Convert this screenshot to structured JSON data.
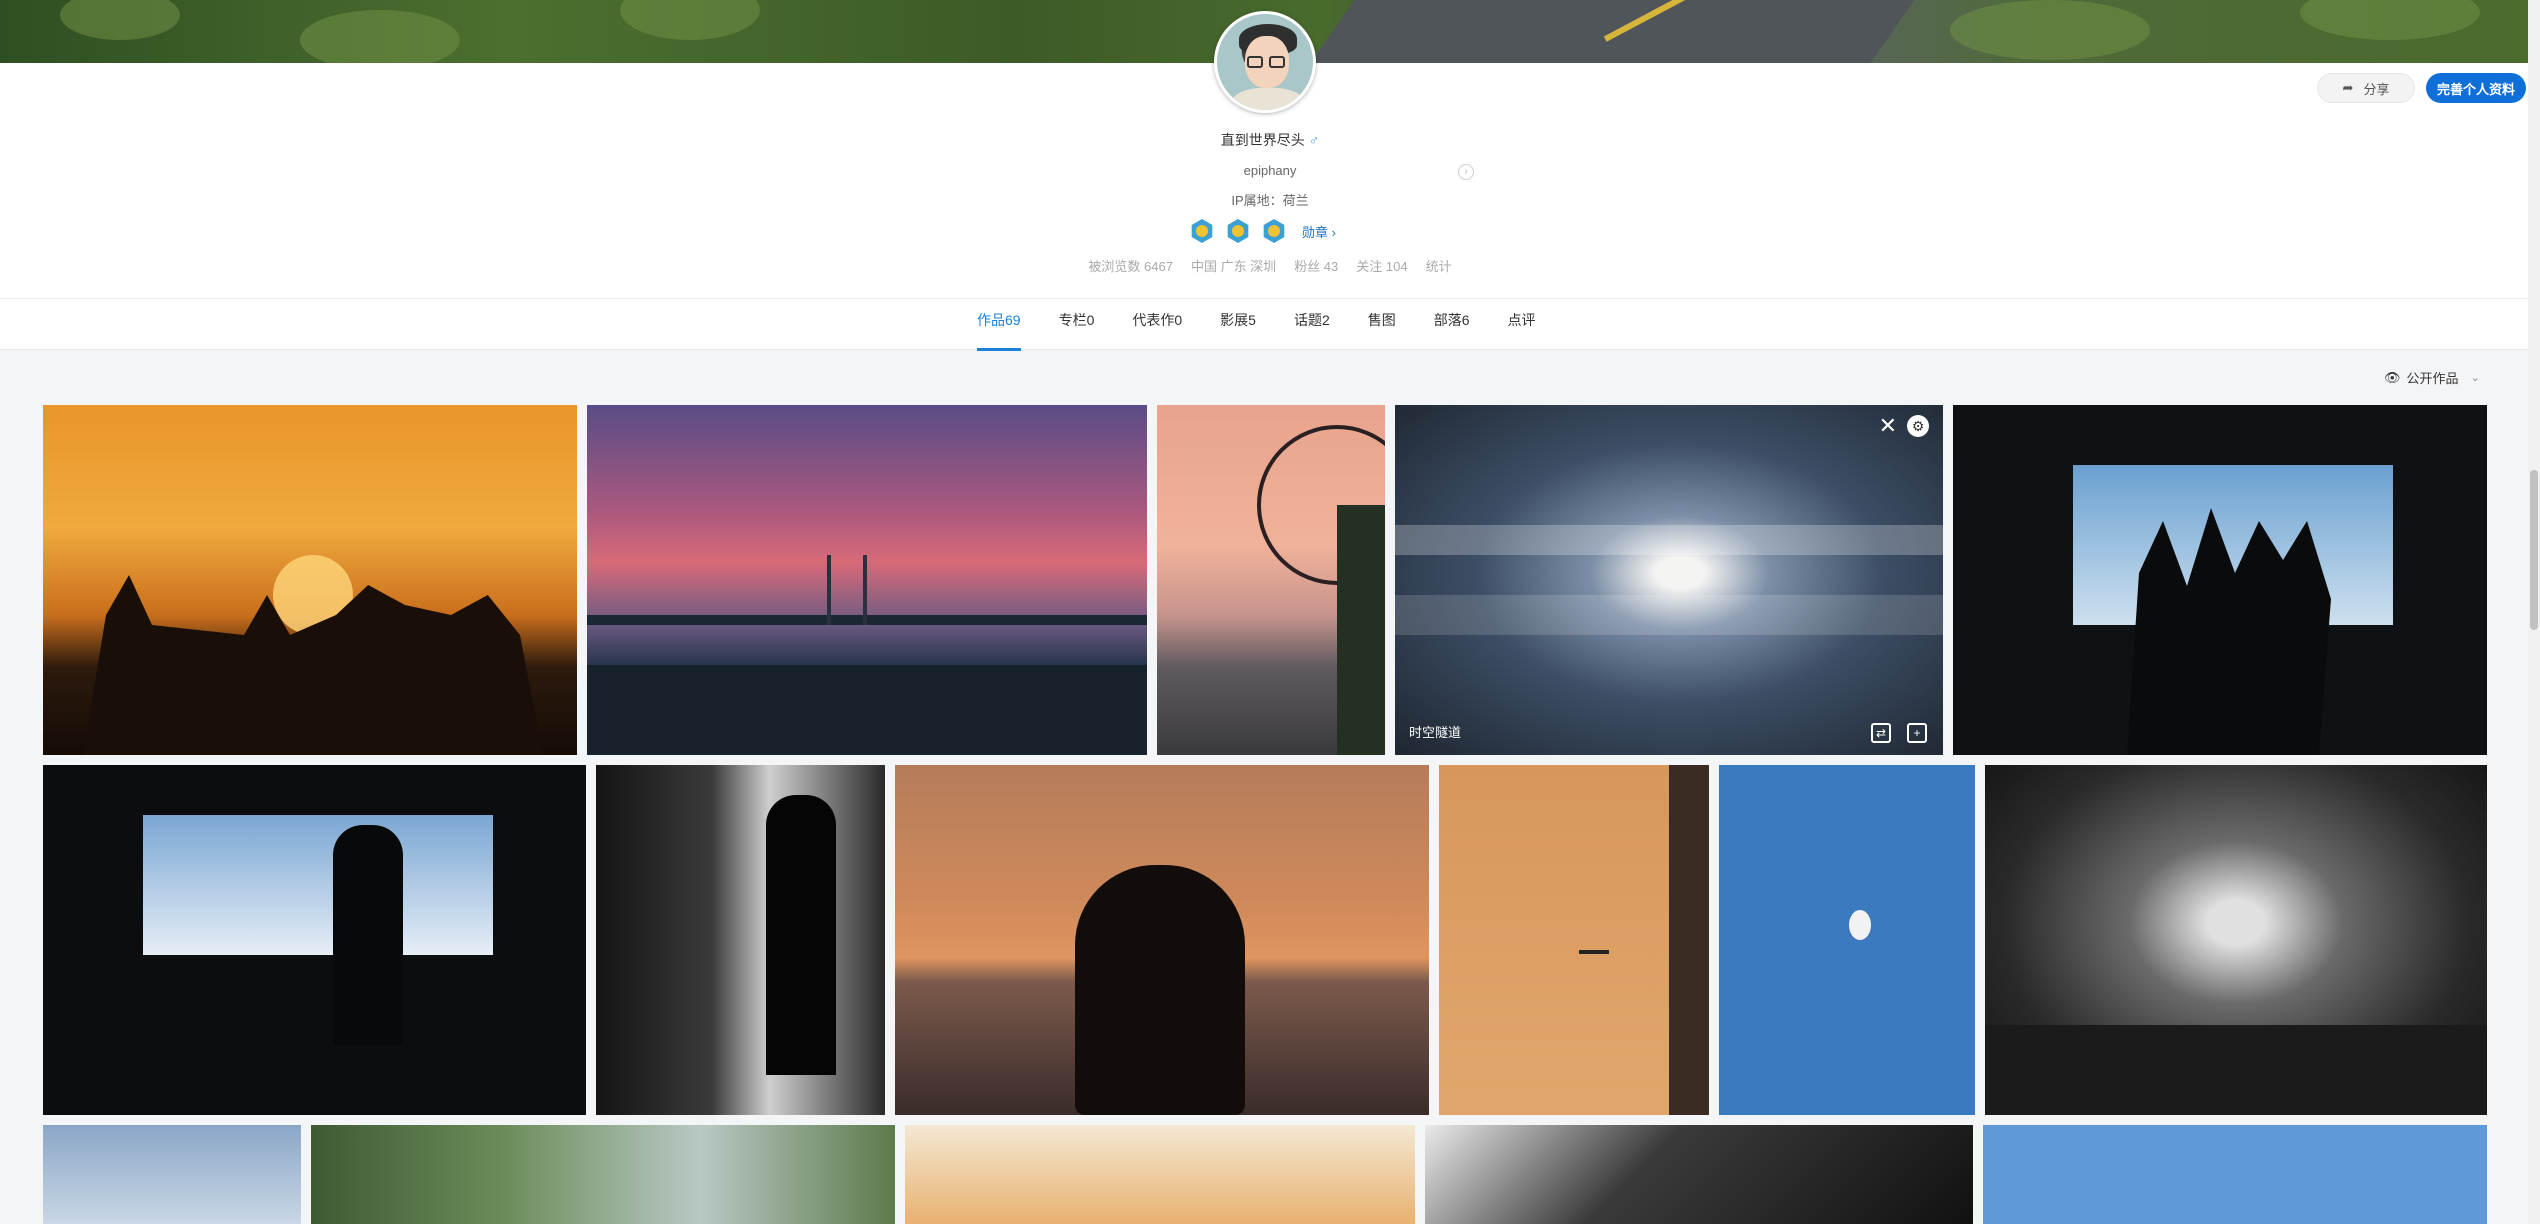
{
  "profile": {
    "nickname": "直到世界尽头",
    "gender_symbol": "♂",
    "username": "epiphany",
    "ip_location": "IP属地：荷兰",
    "medal_link": "勋章 ›",
    "stats": [
      "被浏览数 6467",
      "中国 广东 深圳",
      "粉丝 43",
      "关注 104",
      "统计"
    ]
  },
  "actions": {
    "share_label": "分享",
    "edit_label": "完善个人资料"
  },
  "tabs": [
    {
      "label": "作品69",
      "active": true
    },
    {
      "label": "专栏0"
    },
    {
      "label": "代表作0"
    },
    {
      "label": "影展5"
    },
    {
      "label": "话题2"
    },
    {
      "label": "售图"
    },
    {
      "label": "部落6"
    },
    {
      "label": "点评"
    }
  ],
  "filter": {
    "label": "公开作品"
  },
  "works": {
    "hovered_title": "时空隧道"
  }
}
